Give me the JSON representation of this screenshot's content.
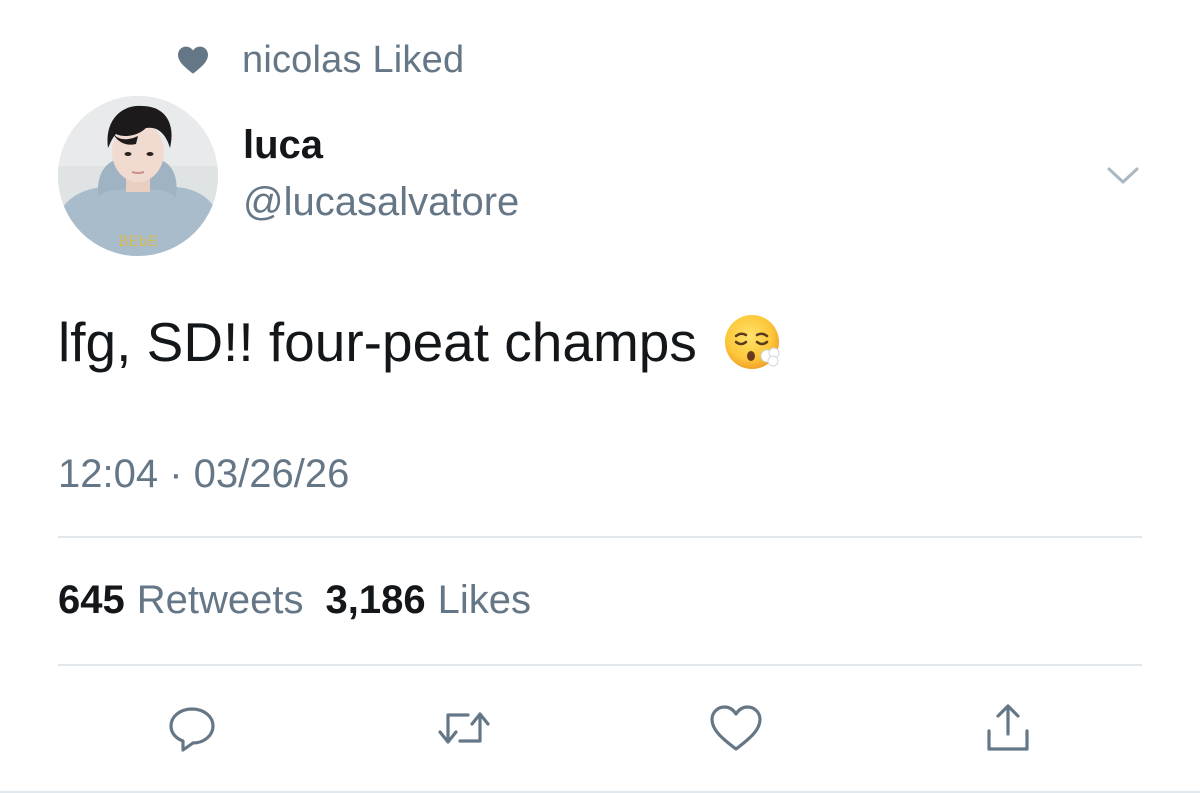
{
  "social_context": {
    "icon": "heart-icon",
    "text": "nicolas Liked"
  },
  "author": {
    "display_name": "luca",
    "handle": "@lucasalvatore",
    "avatar_hoodie_print": "BEbE"
  },
  "tweet": {
    "text": "lfg, SD!! four-peat champs",
    "emoji": "face-exhaling-emoji",
    "timestamp": "12:04 · 03/26/26"
  },
  "stats": {
    "retweets_count": "645",
    "retweets_label": "Retweets",
    "likes_count": "3,186",
    "likes_label": "Likes"
  },
  "actions": [
    {
      "name": "reply",
      "icon": "reply-icon"
    },
    {
      "name": "retweet",
      "icon": "retweet-icon"
    },
    {
      "name": "like",
      "icon": "heart-outline-icon"
    },
    {
      "name": "share",
      "icon": "share-icon"
    }
  ],
  "colors": {
    "primary_text": "#14171a",
    "secondary_text": "#657786",
    "divider": "#e1e8ed",
    "icon": "#657786"
  }
}
